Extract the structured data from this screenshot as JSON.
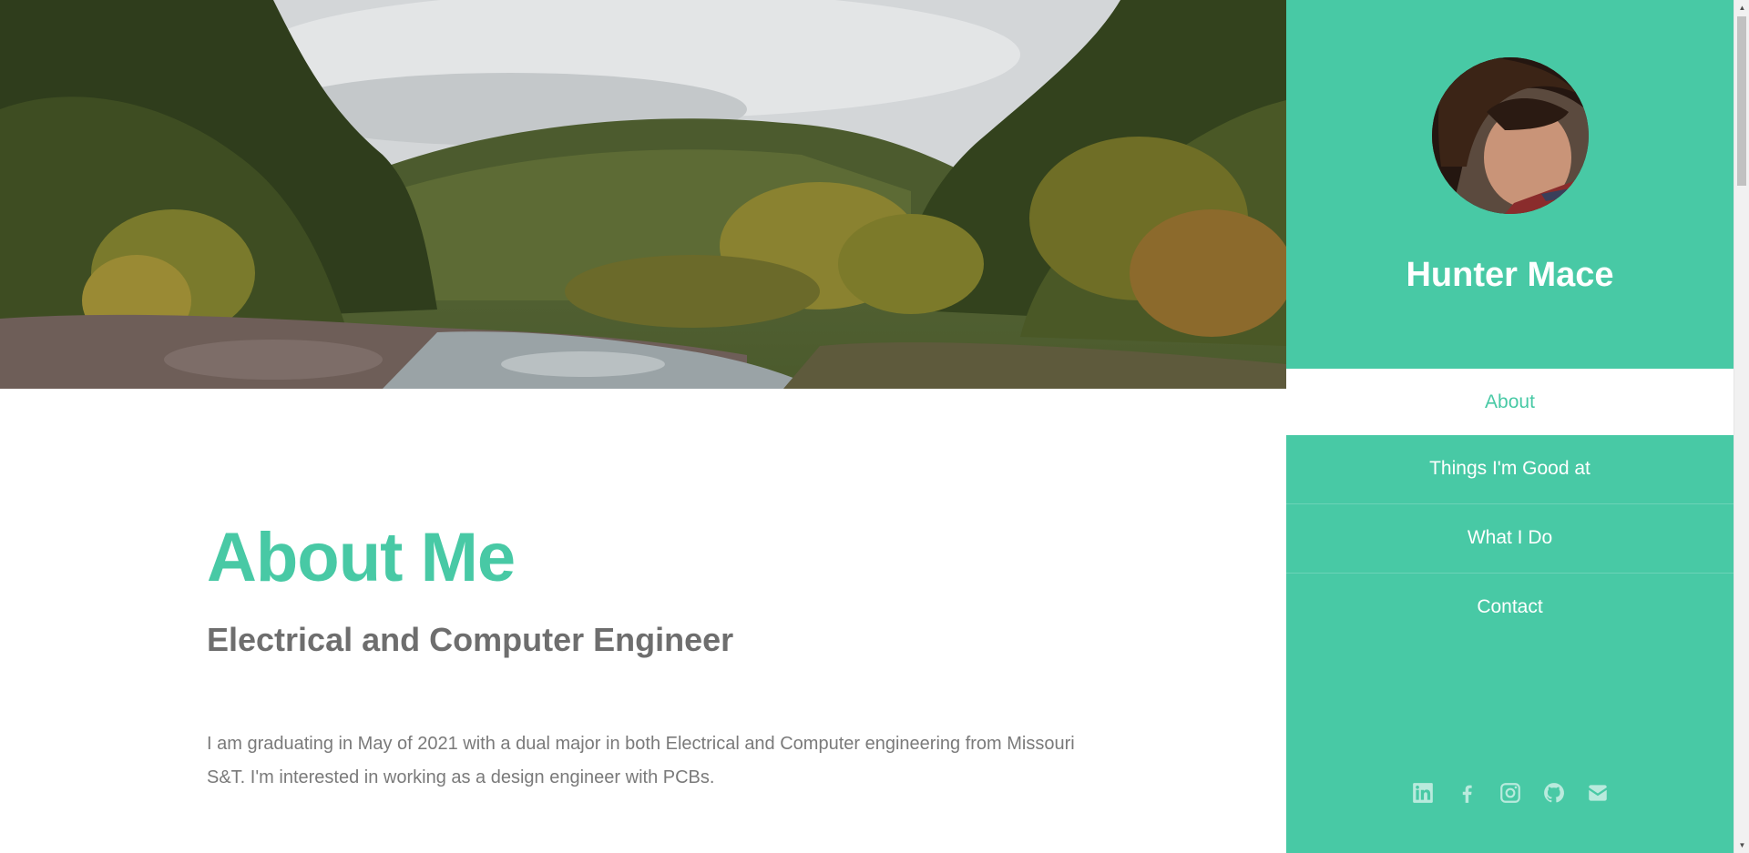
{
  "sidebar": {
    "name": "Hunter Mace",
    "nav": [
      {
        "label": "About",
        "active": true
      },
      {
        "label": "Things I'm Good at",
        "active": false
      },
      {
        "label": "What I Do",
        "active": false
      },
      {
        "label": "Contact",
        "active": false
      }
    ],
    "social_icons": [
      "linkedin-icon",
      "facebook-icon",
      "instagram-icon",
      "github-icon",
      "envelope-icon"
    ]
  },
  "main": {
    "title": "About Me",
    "subtitle": "Electrical and Computer Engineer",
    "bio": "I am graduating in May of 2021 with a dual major in both Electrical and Computer engineering from Missouri S&T. I'm interested in working as a design engineer with PCBs."
  },
  "colors": {
    "accent": "#48c9a5",
    "text_gray": "#7a7a7a",
    "heading_gray": "#6e6e6e"
  }
}
